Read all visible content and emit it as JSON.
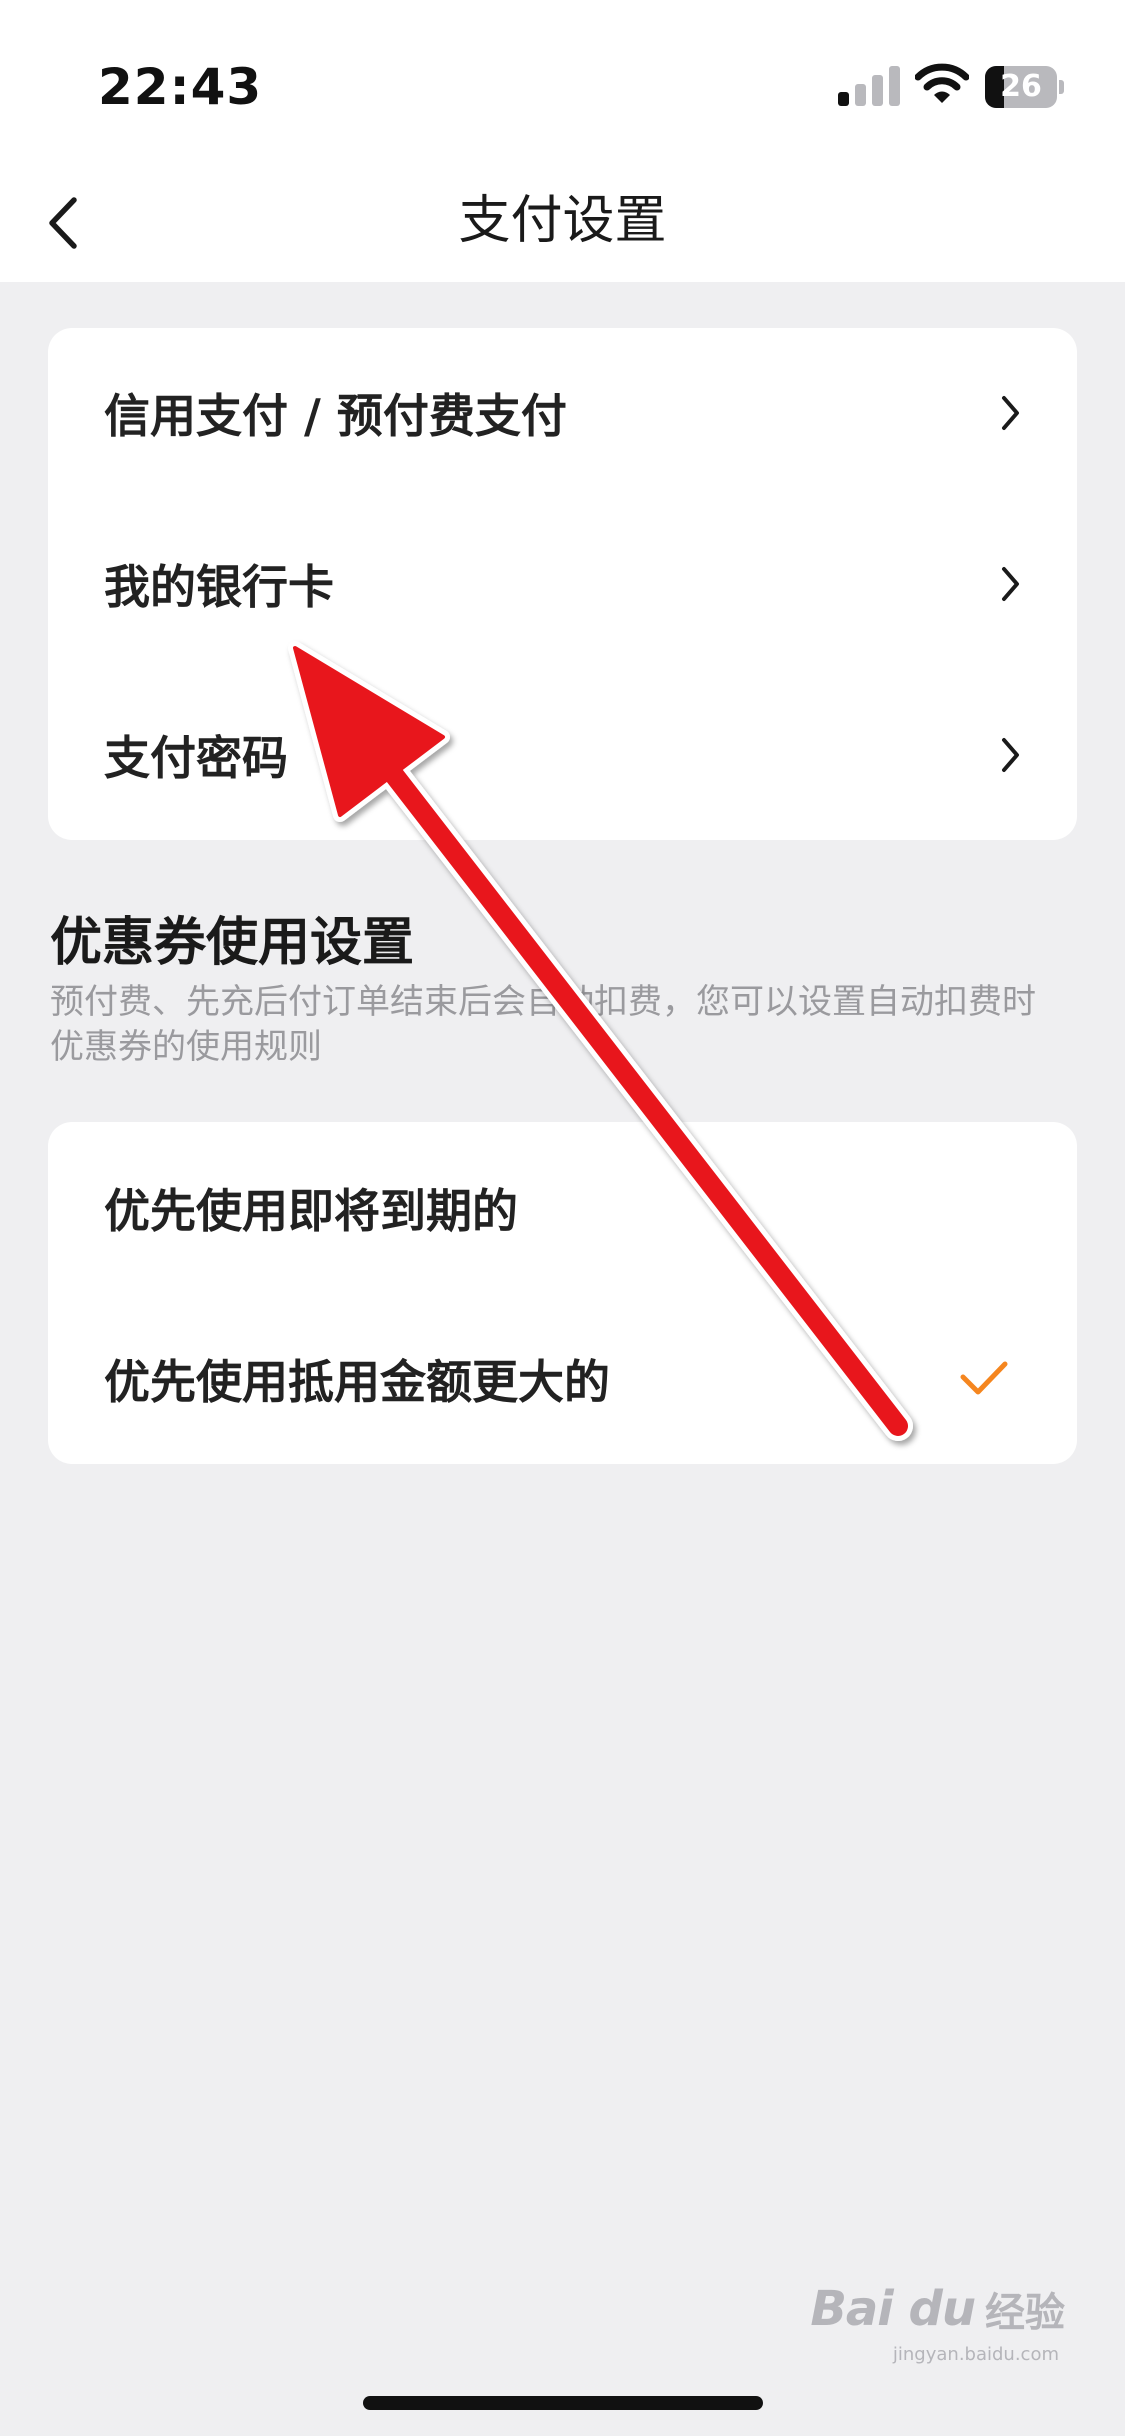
{
  "status_bar": {
    "time": "22:43",
    "battery_level": "26",
    "battery_fraction": 0.26
  },
  "nav": {
    "title": "支付设置",
    "back_icon": "chevron-left-icon"
  },
  "payment_settings": {
    "items": [
      {
        "label": "信用支付 / 预付费支付",
        "icon": "chevron-right-icon"
      },
      {
        "label": "我的银行卡",
        "icon": "chevron-right-icon"
      },
      {
        "label": "支付密码",
        "icon": "chevron-right-icon"
      }
    ]
  },
  "coupon_settings": {
    "title": "优惠券使用设置",
    "description": "预付费、先充后付订单结束后会自动扣费，您可以设置自动扣费时优惠券的使用规则",
    "options": [
      {
        "label": "优先使用即将到期的",
        "selected": false
      },
      {
        "label": "优先使用抵用金额更大的",
        "selected": true
      }
    ]
  },
  "colors": {
    "accent": "#f5861f",
    "page_background": "#efeff1",
    "annotation_arrow": "#e8141c"
  },
  "watermark": {
    "logo": "Bai du",
    "text": "经验",
    "url": "jingyan.baidu.com"
  }
}
